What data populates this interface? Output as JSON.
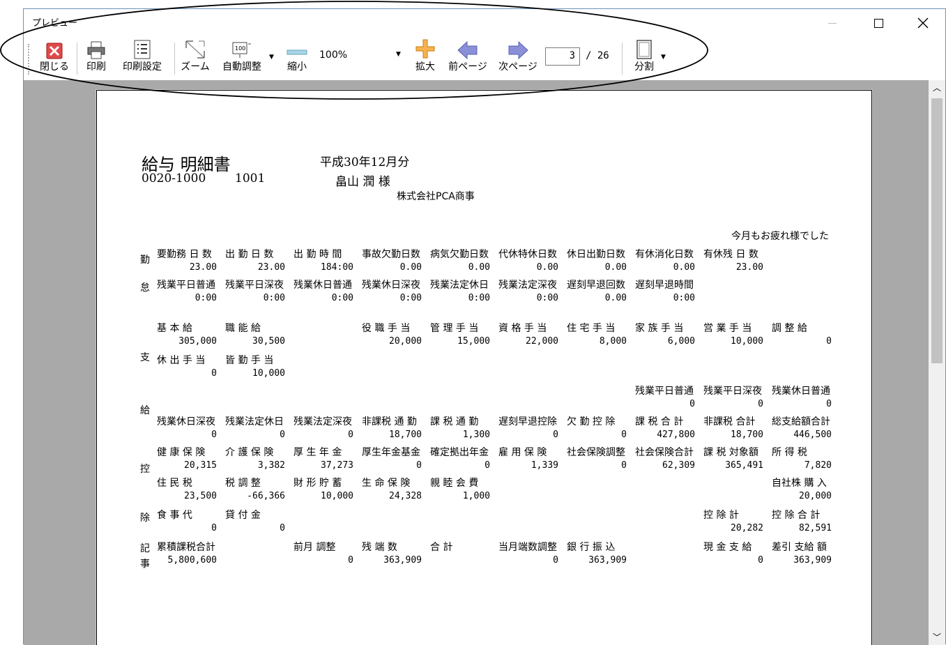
{
  "window": {
    "title": "プレビュー"
  },
  "toolbar": {
    "close": "閉じる",
    "print": "印刷",
    "print_settings": "印刷設定",
    "zoom": "ズーム",
    "auto_adjust": "自動調整",
    "shrink": "縮小",
    "zoom_value": "100%",
    "enlarge": "拡大",
    "prev_page": "前ページ",
    "next_page": "次ページ",
    "current_page": "3",
    "total_pages": "/ 26",
    "split": "分割",
    "auto_icon_text": "100"
  },
  "doc": {
    "title": "給与 明細書",
    "period": "平成30年12月分",
    "code": "0020-1000",
    "emp_no": "1001",
    "name": "畠山 潤 様",
    "company": "株式会社PCA商事",
    "message": "今月もお疲れ様でした",
    "sec_kinmu": [
      "勤",
      "怠"
    ],
    "sec_shikyu": [
      "支",
      "給"
    ],
    "sec_koujo": [
      "控",
      "除"
    ],
    "sec_kiji": [
      "記",
      "事"
    ],
    "att1_labels": [
      "要勤務 日 数",
      "出 勤 日 数",
      "出 勤 時 間",
      "事故欠勤日数",
      "病気欠勤日数",
      "代休特休日数",
      "休日出勤日数",
      "有休消化日数",
      "有休残 日 数"
    ],
    "att1_values": [
      "23.00",
      "23.00",
      "184:00",
      "0.00",
      "0.00",
      "0.00",
      "0.00",
      "0.00",
      "23.00"
    ],
    "att2_labels": [
      "残業平日普通",
      "残業平日深夜",
      "残業休日普通",
      "残業休日深夜",
      "残業法定休日",
      "残業法定深夜",
      "遅刻早退回数",
      "遅刻早退時間"
    ],
    "att2_values": [
      "0:00",
      "0:00",
      "0:00",
      "0:00",
      "0:00",
      "0:00",
      "0.00",
      "0:00"
    ],
    "pay1_labels": [
      "基 本 給",
      "職 能 給",
      "役 職 手 当",
      "管 理 手 当",
      "資 格 手 当",
      "住 宅 手 当",
      "家 族 手 当",
      "営 業 手 当",
      "調 整 給"
    ],
    "pay1_values": [
      "305,000",
      "30,500",
      "20,000",
      "15,000",
      "22,000",
      "8,000",
      "6,000",
      "10,000",
      "0"
    ],
    "pay2_labels": [
      "休 出 手 当",
      "皆 勤 手 当"
    ],
    "pay2_values": [
      "0",
      "10,000"
    ],
    "pay3_labels": [
      "残業平日普通",
      "残業平日深夜",
      "残業休日普通"
    ],
    "pay3_values": [
      "0",
      "0",
      "0"
    ],
    "pay4_labels": [
      "残業休日深夜",
      "残業法定休日",
      "残業法定深夜",
      "非課税 通 勤",
      "課 税 通 勤",
      "遅刻早退控除",
      "欠 勤 控 除",
      "課 税 合 計",
      "非課税 合計",
      "総支給額合計"
    ],
    "pay4_values": [
      "0",
      "0",
      "0",
      "18,700",
      "1,300",
      "0",
      "0",
      "427,800",
      "18,700",
      "446,500"
    ],
    "ded1_labels": [
      "健 康 保 険",
      "介 護 保 険",
      "厚 生 年 金",
      "厚生年金基金",
      "確定拠出年金",
      "雇 用 保 険",
      "社会保険調整",
      "社会保険合計",
      "課 税 対象額",
      "所 得 税"
    ],
    "ded1_values": [
      "20,315",
      "3,382",
      "37,273",
      "0",
      "0",
      "1,339",
      "0",
      "62,309",
      "365,491",
      "7,820"
    ],
    "ded2_labels": [
      "住 民 税",
      "税 調 整",
      "財 形 貯 蓄",
      "生 命 保 険",
      "親 睦 会 費",
      "自社株 購 入"
    ],
    "ded2_values": [
      "23,500",
      "-66,366",
      "10,000",
      "24,328",
      "1,000",
      "20,000"
    ],
    "ded3_labels": [
      "食 事 代",
      "貸 付 金",
      "控 除 計",
      "控 除 合 計"
    ],
    "ded3_values": [
      "0",
      "0",
      "20,282",
      "82,591"
    ],
    "rec_labels": [
      "累積課税合計",
      "前月 調整",
      "残 端 数",
      "合 計",
      "当月端数調整",
      "銀 行 振 込",
      "現 金 支 給",
      "差引 支給 額"
    ],
    "rec_values": [
      "5,800,600",
      "0",
      "363,909",
      "0",
      "363,909",
      "0",
      "363,909"
    ]
  }
}
